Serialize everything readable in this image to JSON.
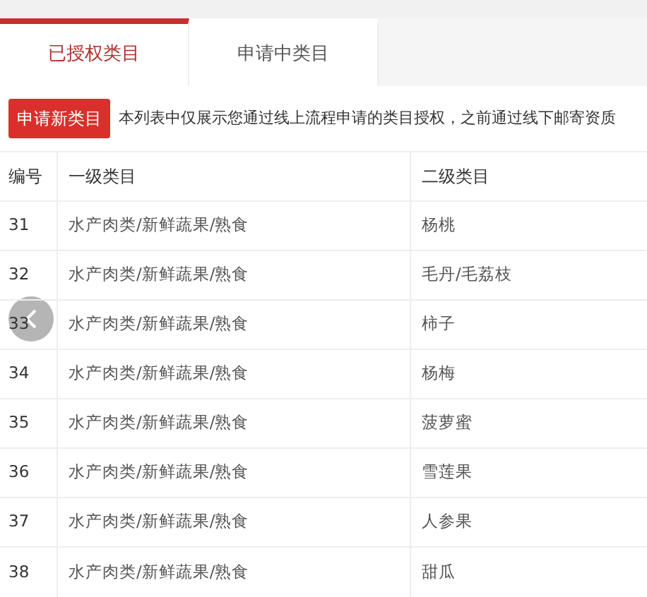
{
  "tabs": [
    {
      "label": "已授权类目",
      "selected": true
    },
    {
      "label": "申请中类目",
      "selected": false
    }
  ],
  "apply_button": "申请新类目",
  "notice": "本列表中仅展示您通过线上流程申请的类目授权，之前通过线下邮寄资质",
  "table": {
    "columns": [
      "编号",
      "一级类目",
      "二级类目"
    ],
    "rows": [
      [
        "31",
        "水产肉类/新鲜蔬果/熟食",
        "杨桃"
      ],
      [
        "32",
        "水产肉类/新鲜蔬果/熟食",
        "毛丹/毛荔枝"
      ],
      [
        "33",
        "水产肉类/新鲜蔬果/熟食",
        "柿子"
      ],
      [
        "34",
        "水产肉类/新鲜蔬果/熟食",
        "杨梅"
      ],
      [
        "35",
        "水产肉类/新鲜蔬果/熟食",
        "菠萝蜜"
      ],
      [
        "36",
        "水产肉类/新鲜蔬果/熟食",
        "雪莲果"
      ],
      [
        "37",
        "水产肉类/新鲜蔬果/熟食",
        "人参果"
      ],
      [
        "38",
        "水产肉类/新鲜蔬果/熟食",
        "甜瓜"
      ]
    ]
  }
}
